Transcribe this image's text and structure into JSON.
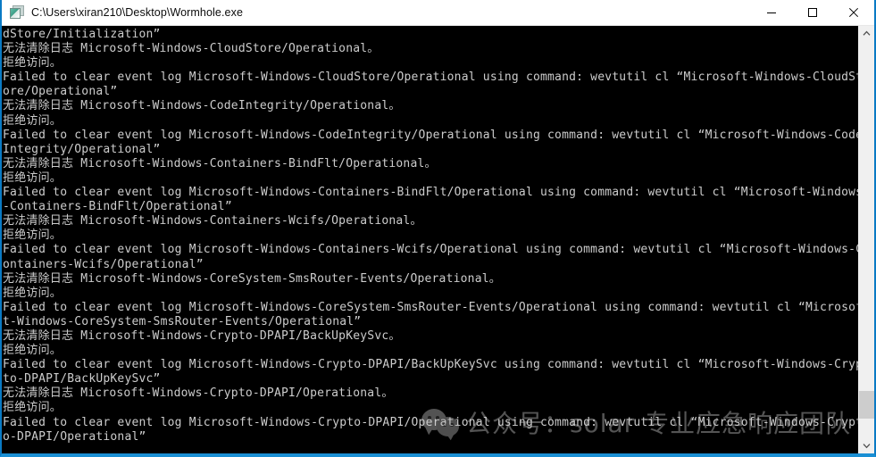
{
  "window": {
    "title": "C:\\Users\\xiran210\\Desktop\\Wormhole.exe",
    "icon": "console-app-icon",
    "accent_color": "#0a7ac4",
    "titlebar_background": "#ffffff",
    "console_background": "#000000",
    "console_foreground": "#cccccc"
  },
  "titlebar_buttons": {
    "minimize_label": "—",
    "maximize_label": "□",
    "close_label": "✕"
  },
  "console": {
    "text": "dStore/Initialization”\n无法清除日志 Microsoft-Windows-CloudStore/Operational。\n拒绝访问。\nFailed to clear event log Microsoft-Windows-CloudStore/Operational using command: wevtutil cl “Microsoft-Windows-CloudSt\nore/Operational”\n无法清除日志 Microsoft-Windows-CodeIntegrity/Operational。\n拒绝访问。\nFailed to clear event log Microsoft-Windows-CodeIntegrity/Operational using command: wevtutil cl “Microsoft-Windows-Code\nIntegrity/Operational”\n无法清除日志 Microsoft-Windows-Containers-BindFlt/Operational。\n拒绝访问。\nFailed to clear event log Microsoft-Windows-Containers-BindFlt/Operational using command: wevtutil cl “Microsoft-Windows\n-Containers-BindFlt/Operational”\n无法清除日志 Microsoft-Windows-Containers-Wcifs/Operational。\n拒绝访问。\nFailed to clear event log Microsoft-Windows-Containers-Wcifs/Operational using command: wevtutil cl “Microsoft-Windows-C\nontainers-Wcifs/Operational”\n无法清除日志 Microsoft-Windows-CoreSystem-SmsRouter-Events/Operational。\n拒绝访问。\nFailed to clear event log Microsoft-Windows-CoreSystem-SmsRouter-Events/Operational using command: wevtutil cl “Microsof\nt-Windows-CoreSystem-SmsRouter-Events/Operational”\n无法清除日志 Microsoft-Windows-Crypto-DPAPI/BackUpKeySvc。\n拒绝访问。\nFailed to clear event log Microsoft-Windows-Crypto-DPAPI/BackUpKeySvc using command: wevtutil cl “Microsoft-Windows-Cryp\nto-DPAPI/BackUpKeySvc”\n无法清除日志 Microsoft-Windows-Crypto-DPAPI/Operational。\n拒绝访问。\nFailed to clear event log Microsoft-Windows-Crypto-DPAPI/Operational using command: wevtutil cl “Microsoft-Windows-Crypt\no-DPAPI/Operational”"
  },
  "scrollbar": {
    "up_arrow": "⌃",
    "down_arrow": "⌄",
    "thumb_top_percent": 88,
    "thumb_height_percent": 7
  },
  "watermark": {
    "logo": "wechat-icon",
    "text": "公众号：solar 专业应急响应团队"
  }
}
